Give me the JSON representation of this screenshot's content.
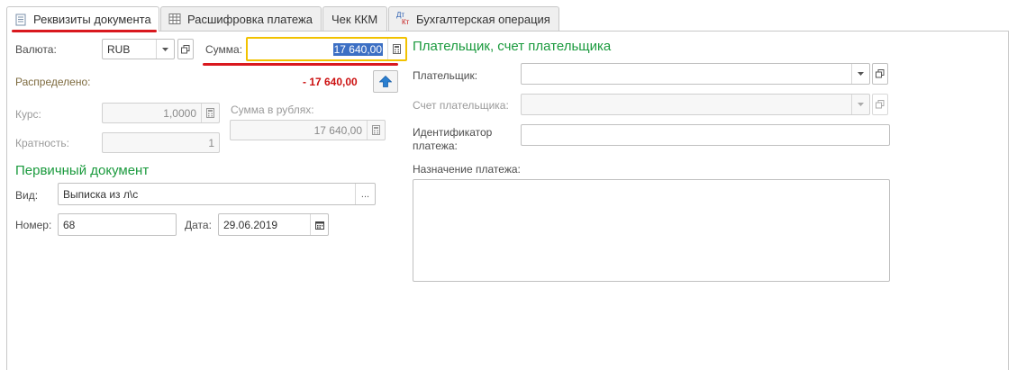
{
  "tabs": [
    {
      "label": "Реквизиты документа",
      "icon": "document-icon",
      "active": true
    },
    {
      "label": "Расшифровка платежа",
      "icon": "table-icon",
      "active": false
    },
    {
      "label": "Чек ККМ",
      "icon": "",
      "active": false
    },
    {
      "label": "Бухгалтерская операция",
      "icon": "dt-kt-icon",
      "active": false
    }
  ],
  "tab_icon_text": {
    "dt": "Дт",
    "kt": "Кт"
  },
  "left": {
    "currency_label": "Валюта:",
    "currency_value": "RUB",
    "sum_label": "Сумма:",
    "sum_value": "17 640,00",
    "distributed_label": "Распределено:",
    "distributed_value": "- 17 640,00",
    "rate_label": "Курс:",
    "rate_value": "1,0000",
    "sum_rub_label": "Сумма в рублях:",
    "sum_rub_value": "17 640,00",
    "multiplicity_label": "Кратность:",
    "multiplicity_value": "1"
  },
  "primary_doc": {
    "title": "Первичный документ",
    "kind_label": "Вид:",
    "kind_value": "Выписка из л\\с",
    "kind_button": "...",
    "number_label": "Номер:",
    "number_value": "68",
    "date_label": "Дата:",
    "date_value": "29.06.2019"
  },
  "payer": {
    "title": "Плательщик, счет плательщика",
    "payer_label": "Плательщик:",
    "payer_value": "",
    "account_label": "Счет плательщика:",
    "account_value": "",
    "payment_id_label_1": "Идентификатор",
    "payment_id_label_2": "платежа:",
    "payment_id_value": "",
    "purpose_label": "Назначение платежа:",
    "purpose_value": ""
  },
  "colors": {
    "section_green": "#1a9a3d",
    "distributed_red": "#cc1111",
    "highlight_underline": "#d9181e",
    "focus_border": "#f2c200",
    "selection_blue": "#3c6fc4"
  }
}
